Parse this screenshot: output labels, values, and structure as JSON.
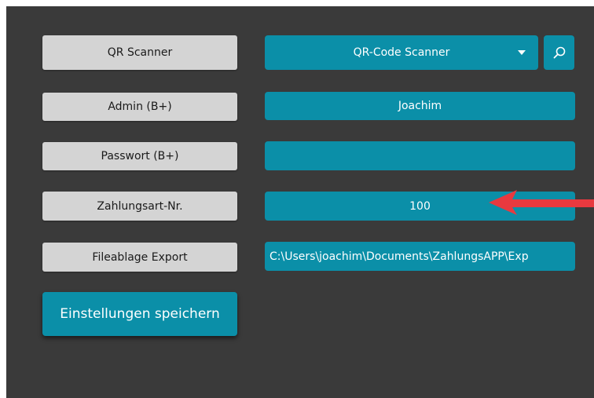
{
  "settings": {
    "rows": [
      {
        "label": "QR Scanner",
        "value": "QR-Code Scanner"
      },
      {
        "label": "Admin (B+)",
        "value": "Joachim"
      },
      {
        "label": "Passwort (B+)",
        "value": ""
      },
      {
        "label": "Zahlungsart-Nr.",
        "value": "100"
      },
      {
        "label": "Fileablage Export",
        "value": "C:\\Users\\joachim\\Documents\\ZahlungsAPP\\Exp"
      }
    ],
    "save_label": "Einstellungen speichern"
  },
  "icons": {
    "dropdown": "chevron-down-icon",
    "search": "search-icon",
    "annotation": "arrow-left-icon"
  },
  "colors": {
    "background": "#3a3a3a",
    "accent": "#0b8fa8",
    "label_bg": "#d4d4d4",
    "annotation_arrow": "#e8393f"
  }
}
